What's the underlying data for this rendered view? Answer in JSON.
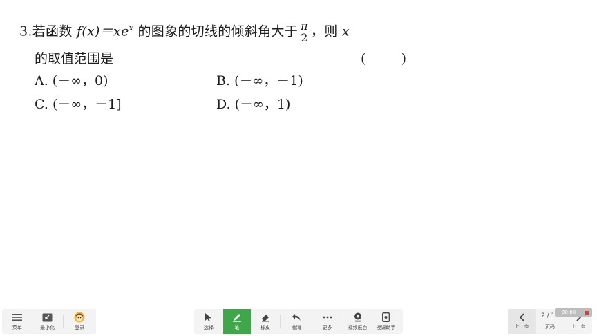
{
  "question": {
    "number": "3.",
    "line1_a": "若函数",
    "func": "f(x)＝xe",
    "sup": "x",
    "line1_b": "的图象的切线的倾斜角大于",
    "frac_num": "π",
    "frac_den": "2",
    "line1_c": "，则",
    "line1_var": "x",
    "line2": "的取值范围是",
    "paren_open": "(",
    "paren_close": ")",
    "options": {
      "A": "A. (－∞，0)",
      "B": "B. (－∞，－1)",
      "C": "C. (－∞，－1]",
      "D": "D. (－∞，1)"
    }
  },
  "toolbar_left": {
    "menu": "菜单",
    "minimize": "最小化",
    "login": "登录"
  },
  "toolbar_center": {
    "select": "选择",
    "pen": "笔",
    "eraser": "橡皮",
    "undo": "撤消",
    "more": "更多",
    "video_booth": "视频展台",
    "assistant": "授课助手"
  },
  "toolbar_right": {
    "prev": "上一页",
    "page_indicator": "2 / 17",
    "page_label": "页码",
    "next": "下一页"
  },
  "recording": {
    "time": "00:00"
  },
  "colors": {
    "accent": "#3fa64a",
    "record": "#e03b2d"
  }
}
